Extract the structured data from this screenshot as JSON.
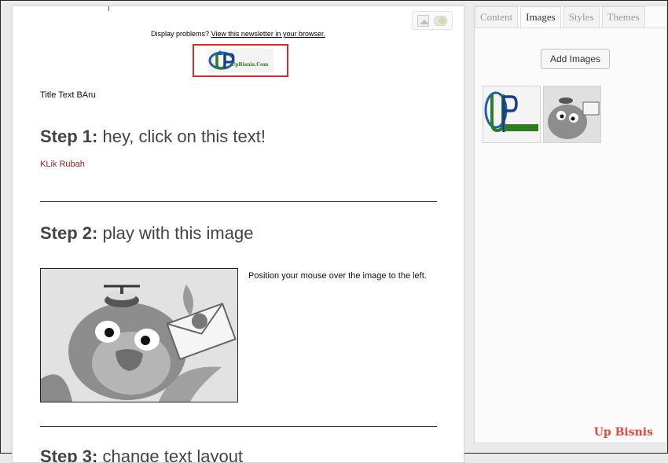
{
  "editor": {
    "display_problems_prefix": "Display problems?",
    "view_in_browser_link": "View this newsletter in your browser.",
    "logo_text": "UpBisnis.Com",
    "title_text": "Title Text BAru",
    "step1": {
      "bold": "Step 1:",
      "rest": " hey, click on this text!"
    },
    "step1_link": "KLik Rubah",
    "step2": {
      "bold": "Step 2:",
      "rest": " play with this image"
    },
    "step2_caption": "Position your mouse over the image to the left.",
    "step3": {
      "bold": "Step 3:",
      "rest": " change text layout"
    }
  },
  "panel": {
    "tabs": [
      {
        "label": "Content",
        "active": false
      },
      {
        "label": "Images",
        "active": true
      },
      {
        "label": "Styles",
        "active": false
      },
      {
        "label": "Themes",
        "active": false
      }
    ],
    "add_images_label": "Add Images"
  },
  "watermark": "Up Bisnis",
  "icons": {
    "image_toggle": "image-icon",
    "toggle_switch": "toggle-switch"
  },
  "colors": {
    "accent_red": "#d32f2f",
    "link_red": "#9b1d1d",
    "watermark": "#e4473b"
  }
}
